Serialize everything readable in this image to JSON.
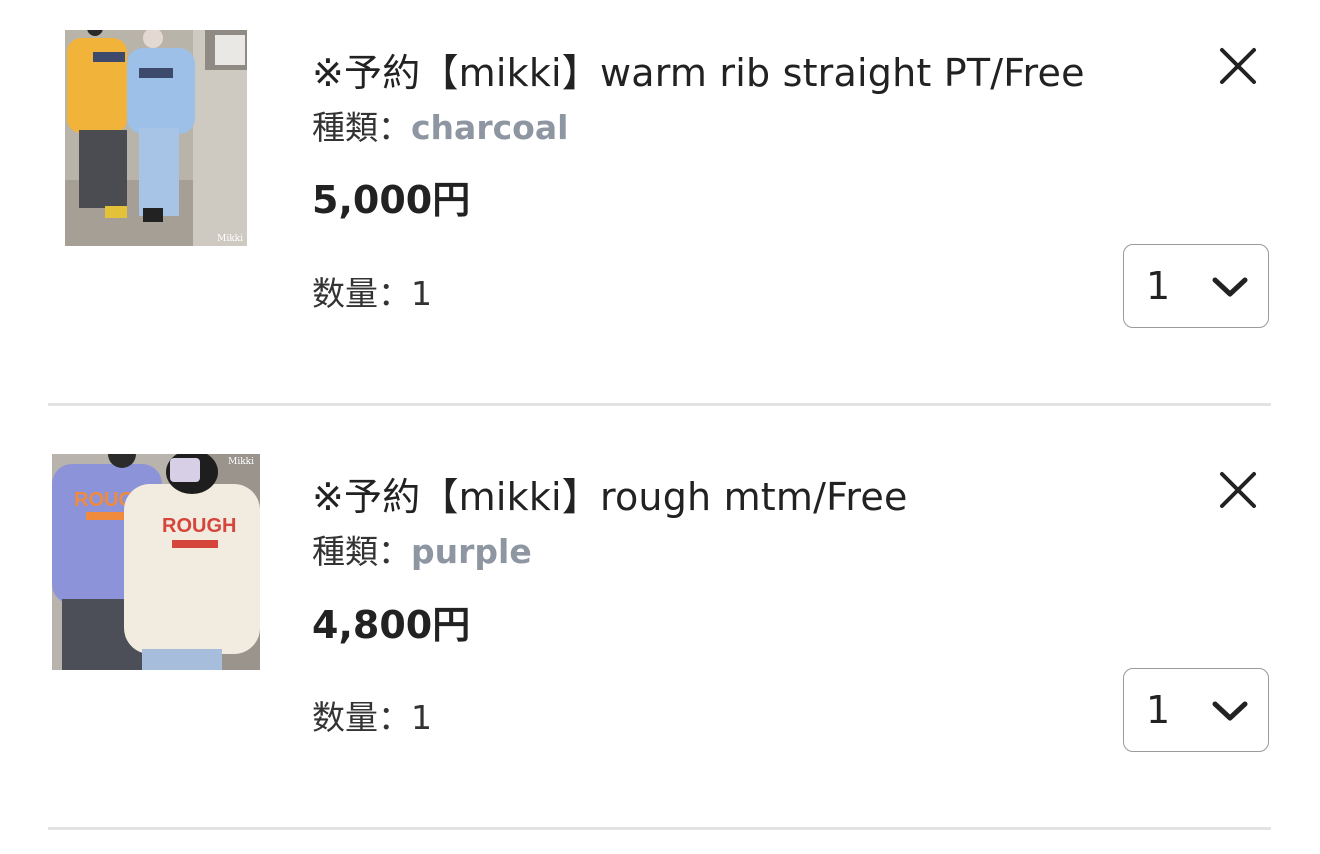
{
  "cart": {
    "items": [
      {
        "title": "※予約【mikki】warm rib straight PT/Free",
        "variant_label": "種類：",
        "variant_value": "charcoal",
        "price": "5,000円",
        "quantity_label": "数量：1",
        "quantity_select_value": "1",
        "image_watermark": "Mikki",
        "remove_icon": "close-icon",
        "select_icon": "chevron-down-icon"
      },
      {
        "title": "※予約【mikki】rough mtm/Free",
        "variant_label": "種類：",
        "variant_value": "purple",
        "price": "4,800円",
        "quantity_label": "数量：1",
        "quantity_select_value": "1",
        "image_watermark": "Mikki",
        "remove_icon": "close-icon",
        "select_icon": "chevron-down-icon"
      }
    ]
  },
  "colors": {
    "variant_value": "#8e96a2",
    "divider": "#e3e3e3",
    "select_border": "#9a9a9a"
  }
}
